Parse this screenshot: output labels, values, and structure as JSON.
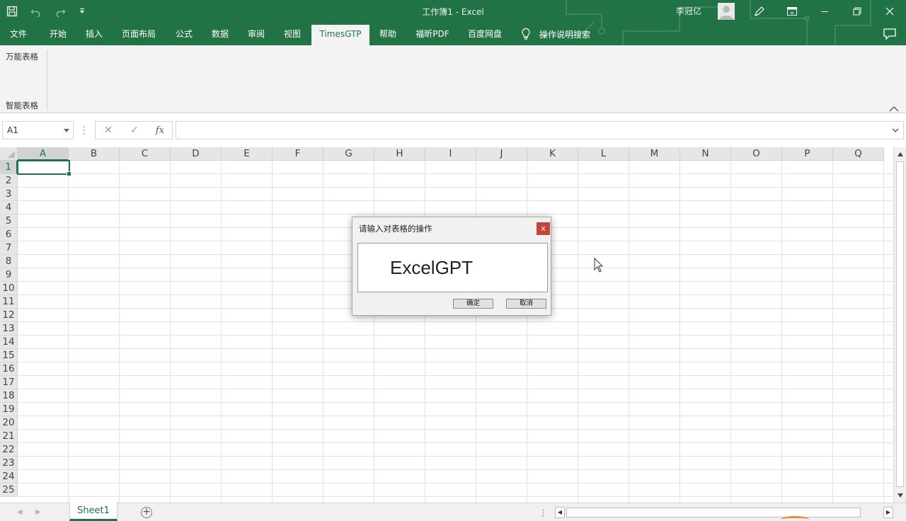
{
  "window": {
    "title": "工作簿1  -  Excel",
    "user": "李冠亿"
  },
  "ribbon_tabs": [
    "文件",
    "开始",
    "插入",
    "页面布局",
    "公式",
    "数据",
    "审阅",
    "视图",
    "TimesGTP",
    "帮助",
    "福昕PDF",
    "百度网盘"
  ],
  "active_tab": "TimesGTP",
  "tell_me": "操作说明搜索",
  "ribbon_commands": [
    "万能表格",
    "智能表格"
  ],
  "formula_bar": {
    "name_box": "A1",
    "cancel": "✕",
    "enter": "✓",
    "fx": "fx",
    "formula": ""
  },
  "grid": {
    "columns": [
      "A",
      "B",
      "C",
      "D",
      "E",
      "F",
      "G",
      "H",
      "I",
      "J",
      "K",
      "L",
      "M",
      "N",
      "O",
      "P",
      "Q"
    ],
    "rows": [
      "1",
      "2",
      "3",
      "4",
      "5",
      "6",
      "7",
      "8",
      "9",
      "10",
      "11",
      "12",
      "13",
      "14",
      "15",
      "16",
      "17",
      "18",
      "19",
      "20",
      "21",
      "22",
      "23",
      "24",
      "25"
    ],
    "selected_cell": "A1"
  },
  "sheets": [
    "Sheet1"
  ],
  "active_sheet": "Sheet1",
  "dialog": {
    "title": "请输入对表格的操作",
    "close": "x",
    "input_value": "ExcelGPT",
    "ok": "确定",
    "cancel": "取消"
  },
  "colors": {
    "brand_green": "#217346",
    "dialog_close_red": "#c6423a"
  },
  "icons": {
    "save": "save-icon",
    "undo": "undo-icon",
    "redo": "redo-icon",
    "customize_qat": "customize-qat-icon",
    "lightbulb": "lightbulb-icon",
    "comments": "comment-icon",
    "pen": "pen-icon",
    "ribbon_display": "ribbon-display-icon",
    "minimize": "minimize-icon",
    "restore": "restore-icon",
    "close": "close-icon"
  }
}
